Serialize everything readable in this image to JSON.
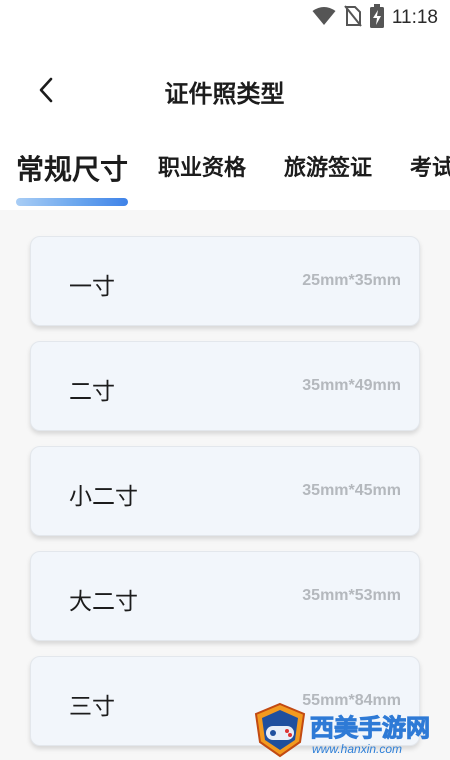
{
  "status_bar": {
    "time": "11:18",
    "icons": [
      "wifi-icon",
      "no-sim-icon",
      "battery-charging-icon"
    ]
  },
  "header": {
    "back_icon": "chevron-left-icon",
    "title": "证件照类型"
  },
  "tabs": [
    {
      "label": "常规尺寸",
      "active": true
    },
    {
      "label": "职业资格",
      "active": false
    },
    {
      "label": "旅游签证",
      "active": false
    },
    {
      "label": "考试",
      "active": false
    }
  ],
  "sizes": [
    {
      "name": "一寸",
      "dimensions": "25mm*35mm"
    },
    {
      "name": "二寸",
      "dimensions": "35mm*49mm"
    },
    {
      "name": "小二寸",
      "dimensions": "35mm*45mm"
    },
    {
      "name": "大二寸",
      "dimensions": "35mm*53mm"
    },
    {
      "name": "三寸",
      "dimensions": "55mm*84mm"
    }
  ],
  "watermark": {
    "text": "西美手游网",
    "url": "www.hanxin.com"
  },
  "colors": {
    "accent": "#3f82e8",
    "card_bg": "#f2f6fb",
    "size_text": "#b4b8bd"
  }
}
